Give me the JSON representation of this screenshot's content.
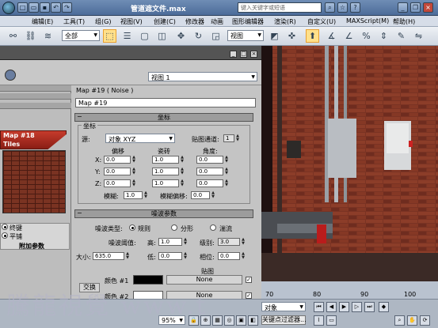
{
  "window": {
    "title": "管道遮文件.max",
    "search_placeholder": "键入关键字或短语"
  },
  "menu": [
    "编辑(E)",
    "工具(T)",
    "组(G)",
    "视图(V)",
    "创建(C)",
    "修改器",
    "动画",
    "图形编辑器",
    "渲染(R)",
    "自定义(U)",
    "MAXScript(M)",
    "帮助(H)"
  ],
  "toolbar": {
    "selection_filter": "全部",
    "ref_coord": "视图"
  },
  "material_editor": {
    "view_select": "视图 1",
    "map_name_field": "Map #19",
    "map_type_label": "Map #19  ( Noise )",
    "sample_label_1": "Map #18",
    "sample_label_2": "Tiles",
    "side_items": [
      "终键",
      "平铺",
      "附加参数"
    ],
    "coords": {
      "rollout": "坐标",
      "group": "坐标",
      "source_label": "源:",
      "source_value": "对象 XYZ",
      "map_channel_label": "贴图通道:",
      "map_channel": "1",
      "col_offset": "偏移",
      "col_tiling": "瓷砖",
      "col_angle": "角度:",
      "rows": [
        {
          "axis": "X:",
          "offset": "0.0",
          "tiling": "1.0",
          "angle": "0.0"
        },
        {
          "axis": "Y:",
          "offset": "0.0",
          "tiling": "1.0",
          "angle": "0.0"
        },
        {
          "axis": "Z:",
          "offset": "0.0",
          "tiling": "1.0",
          "angle": "0.0"
        }
      ],
      "blur_label": "模糊:",
      "blur": "1.0",
      "blur_offset_label": "模糊偏移:",
      "blur_offset": "0.0"
    },
    "noise": {
      "rollout": "噪波参数",
      "type_label": "噪波类型:",
      "types": [
        "规则",
        "分形",
        "湍流"
      ],
      "threshold_label": "噪波阈值:",
      "high_label": "高:",
      "high": "1.0",
      "levels_label": "级别:",
      "levels": "3.0",
      "size_label": "大小:",
      "size": "635.0",
      "low_label": "低:",
      "low": "0.0",
      "phase_label": "相位:",
      "phase": "0.0",
      "maps_label": "贴图",
      "swap_label": "交换",
      "color1_label": "颜色 #1",
      "color2_label": "颜色 #2",
      "map1": "None",
      "map2": "None",
      "color1": "#000000",
      "color2": "#ffffff"
    }
  },
  "timeline": {
    "ticks": [
      "70",
      "80",
      "90",
      "100"
    ]
  },
  "status": {
    "zoom": "95%",
    "key_filter_label": "关键点过滤器...",
    "object_select": "对象"
  },
  "watermark": "騰龍視覺 www.t"
}
